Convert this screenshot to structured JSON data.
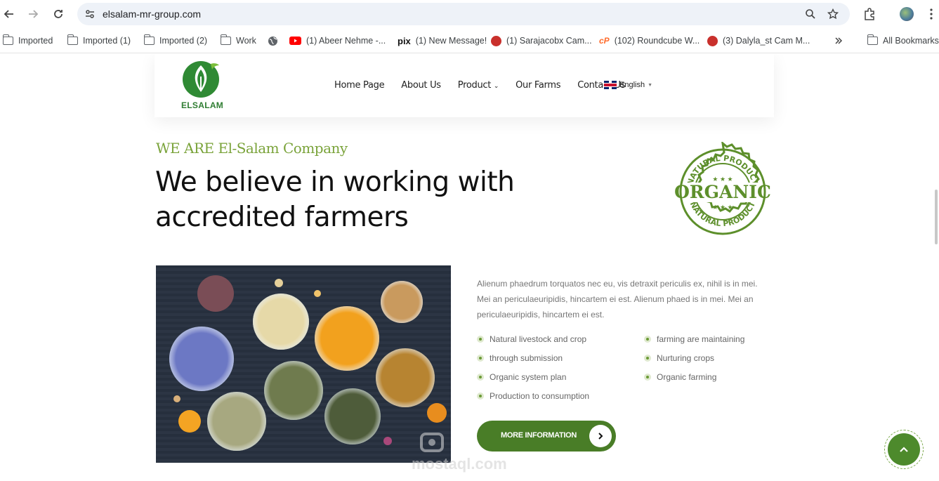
{
  "browser": {
    "url": "elsalam-mr-group.com",
    "bookmarks": [
      {
        "label": "Imported",
        "icon": "folder-icon"
      },
      {
        "label": "Imported (1)",
        "icon": "folder-icon"
      },
      {
        "label": "Imported (2)",
        "icon": "folder-icon"
      },
      {
        "label": "Work",
        "icon": "folder-icon"
      },
      {
        "label": "",
        "icon": "globe-icon"
      },
      {
        "label": "(1) Abeer Nehme -...",
        "icon": "youtube-icon"
      },
      {
        "label": "(1) New Message!",
        "icon": "pix-icon"
      },
      {
        "label": "(1) Sarajacobx Cam...",
        "icon": "chat-icon"
      },
      {
        "label": "(102) Roundcube W...",
        "icon": "cpanel-icon"
      },
      {
        "label": "(3) Dalyla_st Cam M...",
        "icon": "chat-icon"
      }
    ],
    "all_bookmarks": "All Bookmarks"
  },
  "site": {
    "logo_text": "ELSALAM",
    "menu": [
      "Home Page",
      "About Us",
      "Product",
      "Our Farms",
      "Contact Us"
    ],
    "language": "English"
  },
  "hero": {
    "eyebrow": "WE ARE El-Salam Company",
    "headline_line1": "We believe in working with",
    "headline_line2": "accredited farmers",
    "badge": {
      "top": "NATURAL PRODUCT",
      "center": "ORGANIC",
      "bottom": "NATURAL PRODUCT"
    }
  },
  "content": {
    "paragraph": "Alienum phaedrum torquatos nec eu, vis detraxit periculis ex, nihil is in mei. Mei an periculaeuripidis, hincartem ei est. Alienum phaed is in mei. Mei an periculaeuripidis, hincartem ei est.",
    "list_left": [
      "Natural livestock and crop",
      "through submission",
      "Organic system plan",
      "Production to consumption"
    ],
    "list_right": [
      "farming are maintaining",
      "Nurturing crops",
      "Organic farming"
    ],
    "button_label": "MORE INFORMATION"
  },
  "watermark": "mostaql.com",
  "colors": {
    "brand_green": "#497d27",
    "accent_green": "#7aa33a"
  }
}
